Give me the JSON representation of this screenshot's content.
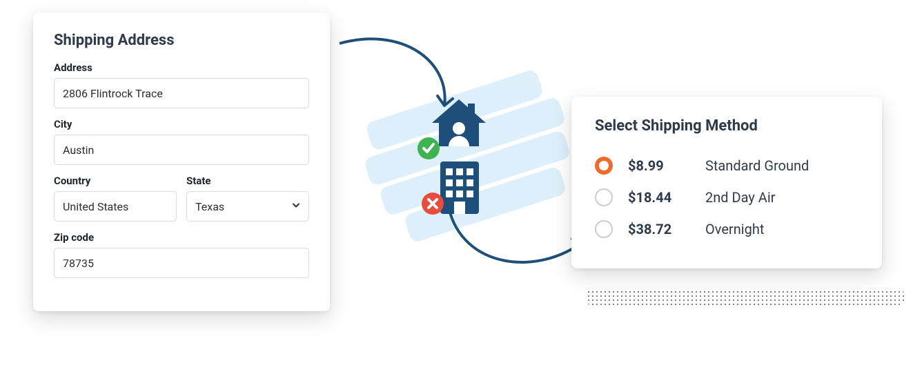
{
  "shipping": {
    "title": "Shipping Address",
    "address_label": "Address",
    "address_value": "2806 Flintrock Trace",
    "city_label": "City",
    "city_value": "Austin",
    "country_label": "Country",
    "country_value": "United States",
    "state_label": "State",
    "state_value": "Texas",
    "zip_label": "Zip code",
    "zip_value": "78735"
  },
  "illustration": {
    "residential_icon": "house-person-icon",
    "residential_status": "ok",
    "commercial_icon": "office-building-icon",
    "commercial_status": "no"
  },
  "method": {
    "title": "Select Shipping Method",
    "options": [
      {
        "price": "$8.99",
        "name": "Standard Ground",
        "selected": true
      },
      {
        "price": "$18.44",
        "name": "2nd Day Air",
        "selected": false
      },
      {
        "price": "$38.72",
        "name": "Overnight",
        "selected": false
      }
    ]
  },
  "colors": {
    "accent": "#ef6a2c",
    "icon_dark": "#1d4f7a",
    "blob": "#daeefa",
    "ok": "#3fb34f",
    "no": "#e84c3d"
  }
}
